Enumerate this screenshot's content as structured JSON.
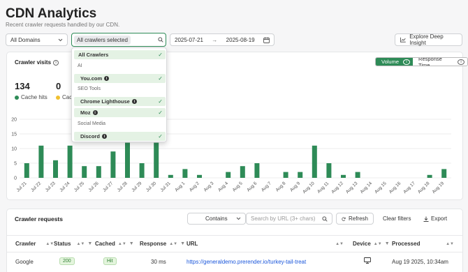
{
  "header": {
    "title": "CDN Analytics",
    "subtitle": "Recent crawler requests handled by our CDN."
  },
  "filters": {
    "domains": "All Domains",
    "crawlers_chip": "All crawlers selected",
    "date_start": "2025-07-21",
    "date_sep": "→",
    "date_end": "2025-08-19",
    "explore": "Explore Deep Insight"
  },
  "crawler_popup": {
    "all": "All Crawlers",
    "groups": [
      {
        "name": "AI",
        "items": [
          "You.com"
        ]
      },
      {
        "name": "SEO Tools",
        "items": [
          "Chrome Lighthouse",
          "Moz"
        ]
      },
      {
        "name": "Social Media",
        "items": [
          "Discord"
        ]
      }
    ]
  },
  "visits": {
    "title": "Crawler visits",
    "toggle_volume": "Volume",
    "toggle_response": "Response Time",
    "stats": [
      {
        "value": "134",
        "label": "Cache hits",
        "color": "#2e8b57"
      },
      {
        "value": "0",
        "label": "Cac",
        "color": "#f0c030"
      }
    ]
  },
  "chart_data": {
    "type": "bar",
    "categories": [
      "Jul 21",
      "Jul 22",
      "Jul 23",
      "Jul 24",
      "Jul 25",
      "Jul 26",
      "Jul 27",
      "Jul 28",
      "Jul 29",
      "Jul 30",
      "Jul 31",
      "Aug 1",
      "Aug 2",
      "Aug 3",
      "Aug 4",
      "Aug 5",
      "Aug 6",
      "Aug 7",
      "Aug 8",
      "Aug 9",
      "Aug 10",
      "Aug 11",
      "Aug 12",
      "Aug 13",
      "Aug 14",
      "Aug 15",
      "Aug 16",
      "Aug 17",
      "Aug 18",
      "Aug 19"
    ],
    "values": [
      5,
      11,
      6,
      11,
      4,
      4,
      9,
      12,
      5,
      12,
      1,
      3,
      1,
      0,
      2,
      4,
      5,
      0,
      2,
      2,
      11,
      5,
      1,
      2,
      0,
      0,
      0,
      0,
      1,
      3
    ],
    "yticks": [
      0,
      5,
      10,
      15,
      20
    ],
    "ylim": [
      0,
      20
    ],
    "grid": true,
    "color": "#2e8b57"
  },
  "requests": {
    "title": "Crawler requests",
    "contains": "Contains",
    "search_placeholder": "Search by URL (3+ chars)",
    "refresh": "Refresh",
    "clear": "Clear filters",
    "export": "Export",
    "columns": [
      "Crawler",
      "Status",
      "Cached",
      "Response",
      "URL",
      "Device",
      "Processed"
    ],
    "rows": [
      {
        "crawler": "Google",
        "status": "200",
        "cached": "Hit",
        "response": "30 ms",
        "url": "https://generaldemo.prerender.io/turkey-tail-treat",
        "device": "desktop-icon",
        "processed": "Aug 19 2025, 10:34am"
      }
    ]
  }
}
